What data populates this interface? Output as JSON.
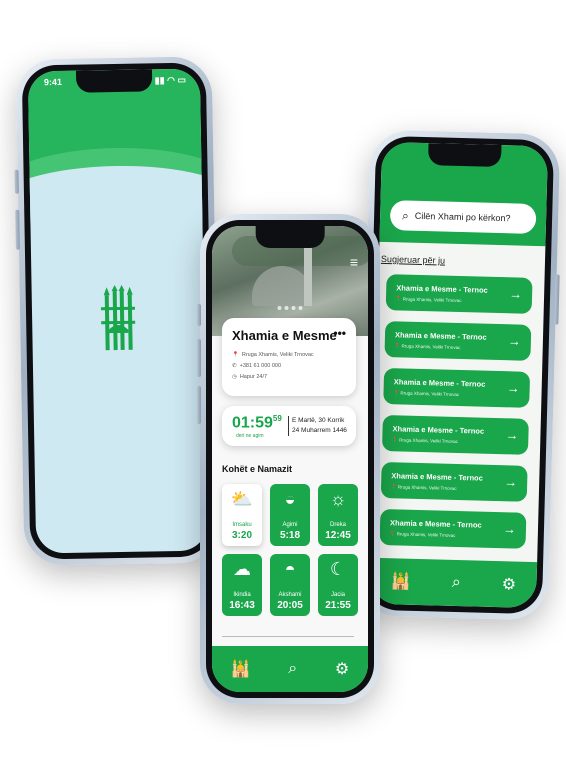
{
  "phone_splash": {
    "status_time": "9:41",
    "status_icons": "▮▮ ◠ ▭"
  },
  "phone_detail": {
    "menu_icon": "≡",
    "mosque_name": "Xhamia e Mesme",
    "more_icon": "•••",
    "address": "Rruga Xhamis, Veliki Trnovac",
    "phone": "+381 61 000 000",
    "hours": "Hapur 24/7",
    "countdown_main": "01:59",
    "countdown_sec": "59",
    "countdown_label": "deri ne agim",
    "date_greg": "E Martë, 30 Korrik",
    "date_hijri": "24 Muharrem 1446",
    "section_title": "Kohët e Namazit",
    "prayers": [
      {
        "name": "Imsaku",
        "time": "3:20",
        "icon": "⛅",
        "active": true
      },
      {
        "name": "Agimi",
        "time": "5:18",
        "icon": "◒",
        "active": false
      },
      {
        "name": "Dreka",
        "time": "12:45",
        "icon": "☼",
        "active": false
      },
      {
        "name": "Ikindia",
        "time": "16:43",
        "icon": "☁",
        "active": false
      },
      {
        "name": "Akshami",
        "time": "20:05",
        "icon": "◓",
        "active": false
      },
      {
        "name": "Jacia",
        "time": "21:55",
        "icon": "☾",
        "active": false
      }
    ],
    "tabs": {
      "home": "🕌",
      "search": "⌕",
      "settings": "⚙"
    }
  },
  "phone_search": {
    "search_placeholder": "Cilën Xhami po kërkon?",
    "suggested_label": "Sugjeruar për ju",
    "items": [
      {
        "name": "Xhamia e Mesme - Ternoc",
        "address": "Rruga Xhamis, Veliki Trnovac"
      },
      {
        "name": "Xhamia e Mesme - Ternoc",
        "address": "Rruga Xhamis, Veliki Trnovac"
      },
      {
        "name": "Xhamia e Mesme - Ternoc",
        "address": "Rruga Xhamis, Veliki Trnovac"
      },
      {
        "name": "Xhamia e Mesme - Ternoc",
        "address": "Rruga Xhamis, Veliki Trnovac"
      },
      {
        "name": "Xhamia e Mesme - Ternoc",
        "address": "Rruga Xhamis, Veliki Trnovac"
      },
      {
        "name": "Xhamia e Mesme - Ternoc",
        "address": "Rruga Xhamis, Veliki Trnovac"
      }
    ],
    "arrow": "→",
    "tabs": {
      "home": "🕌",
      "search": "⌕",
      "settings": "⚙"
    }
  },
  "colors": {
    "brand_green": "#1aa64b",
    "splash_bg": "#cfe9f3"
  }
}
